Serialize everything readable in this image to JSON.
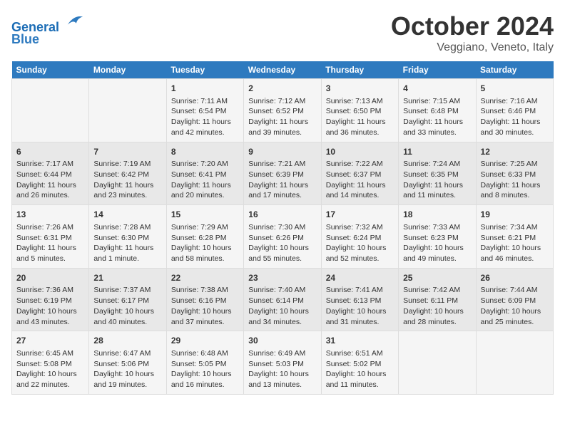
{
  "header": {
    "logo_line1": "General",
    "logo_line2": "Blue",
    "month": "October 2024",
    "location": "Veggiano, Veneto, Italy"
  },
  "weekdays": [
    "Sunday",
    "Monday",
    "Tuesday",
    "Wednesday",
    "Thursday",
    "Friday",
    "Saturday"
  ],
  "weeks": [
    [
      {
        "day": "",
        "info": ""
      },
      {
        "day": "",
        "info": ""
      },
      {
        "day": "1",
        "info": "Sunrise: 7:11 AM\nSunset: 6:54 PM\nDaylight: 11 hours and 42 minutes."
      },
      {
        "day": "2",
        "info": "Sunrise: 7:12 AM\nSunset: 6:52 PM\nDaylight: 11 hours and 39 minutes."
      },
      {
        "day": "3",
        "info": "Sunrise: 7:13 AM\nSunset: 6:50 PM\nDaylight: 11 hours and 36 minutes."
      },
      {
        "day": "4",
        "info": "Sunrise: 7:15 AM\nSunset: 6:48 PM\nDaylight: 11 hours and 33 minutes."
      },
      {
        "day": "5",
        "info": "Sunrise: 7:16 AM\nSunset: 6:46 PM\nDaylight: 11 hours and 30 minutes."
      }
    ],
    [
      {
        "day": "6",
        "info": "Sunrise: 7:17 AM\nSunset: 6:44 PM\nDaylight: 11 hours and 26 minutes."
      },
      {
        "day": "7",
        "info": "Sunrise: 7:19 AM\nSunset: 6:42 PM\nDaylight: 11 hours and 23 minutes."
      },
      {
        "day": "8",
        "info": "Sunrise: 7:20 AM\nSunset: 6:41 PM\nDaylight: 11 hours and 20 minutes."
      },
      {
        "day": "9",
        "info": "Sunrise: 7:21 AM\nSunset: 6:39 PM\nDaylight: 11 hours and 17 minutes."
      },
      {
        "day": "10",
        "info": "Sunrise: 7:22 AM\nSunset: 6:37 PM\nDaylight: 11 hours and 14 minutes."
      },
      {
        "day": "11",
        "info": "Sunrise: 7:24 AM\nSunset: 6:35 PM\nDaylight: 11 hours and 11 minutes."
      },
      {
        "day": "12",
        "info": "Sunrise: 7:25 AM\nSunset: 6:33 PM\nDaylight: 11 hours and 8 minutes."
      }
    ],
    [
      {
        "day": "13",
        "info": "Sunrise: 7:26 AM\nSunset: 6:31 PM\nDaylight: 11 hours and 5 minutes."
      },
      {
        "day": "14",
        "info": "Sunrise: 7:28 AM\nSunset: 6:30 PM\nDaylight: 11 hours and 1 minute."
      },
      {
        "day": "15",
        "info": "Sunrise: 7:29 AM\nSunset: 6:28 PM\nDaylight: 10 hours and 58 minutes."
      },
      {
        "day": "16",
        "info": "Sunrise: 7:30 AM\nSunset: 6:26 PM\nDaylight: 10 hours and 55 minutes."
      },
      {
        "day": "17",
        "info": "Sunrise: 7:32 AM\nSunset: 6:24 PM\nDaylight: 10 hours and 52 minutes."
      },
      {
        "day": "18",
        "info": "Sunrise: 7:33 AM\nSunset: 6:23 PM\nDaylight: 10 hours and 49 minutes."
      },
      {
        "day": "19",
        "info": "Sunrise: 7:34 AM\nSunset: 6:21 PM\nDaylight: 10 hours and 46 minutes."
      }
    ],
    [
      {
        "day": "20",
        "info": "Sunrise: 7:36 AM\nSunset: 6:19 PM\nDaylight: 10 hours and 43 minutes."
      },
      {
        "day": "21",
        "info": "Sunrise: 7:37 AM\nSunset: 6:17 PM\nDaylight: 10 hours and 40 minutes."
      },
      {
        "day": "22",
        "info": "Sunrise: 7:38 AM\nSunset: 6:16 PM\nDaylight: 10 hours and 37 minutes."
      },
      {
        "day": "23",
        "info": "Sunrise: 7:40 AM\nSunset: 6:14 PM\nDaylight: 10 hours and 34 minutes."
      },
      {
        "day": "24",
        "info": "Sunrise: 7:41 AM\nSunset: 6:13 PM\nDaylight: 10 hours and 31 minutes."
      },
      {
        "day": "25",
        "info": "Sunrise: 7:42 AM\nSunset: 6:11 PM\nDaylight: 10 hours and 28 minutes."
      },
      {
        "day": "26",
        "info": "Sunrise: 7:44 AM\nSunset: 6:09 PM\nDaylight: 10 hours and 25 minutes."
      }
    ],
    [
      {
        "day": "27",
        "info": "Sunrise: 6:45 AM\nSunset: 5:08 PM\nDaylight: 10 hours and 22 minutes."
      },
      {
        "day": "28",
        "info": "Sunrise: 6:47 AM\nSunset: 5:06 PM\nDaylight: 10 hours and 19 minutes."
      },
      {
        "day": "29",
        "info": "Sunrise: 6:48 AM\nSunset: 5:05 PM\nDaylight: 10 hours and 16 minutes."
      },
      {
        "day": "30",
        "info": "Sunrise: 6:49 AM\nSunset: 5:03 PM\nDaylight: 10 hours and 13 minutes."
      },
      {
        "day": "31",
        "info": "Sunrise: 6:51 AM\nSunset: 5:02 PM\nDaylight: 10 hours and 11 minutes."
      },
      {
        "day": "",
        "info": ""
      },
      {
        "day": "",
        "info": ""
      }
    ]
  ]
}
